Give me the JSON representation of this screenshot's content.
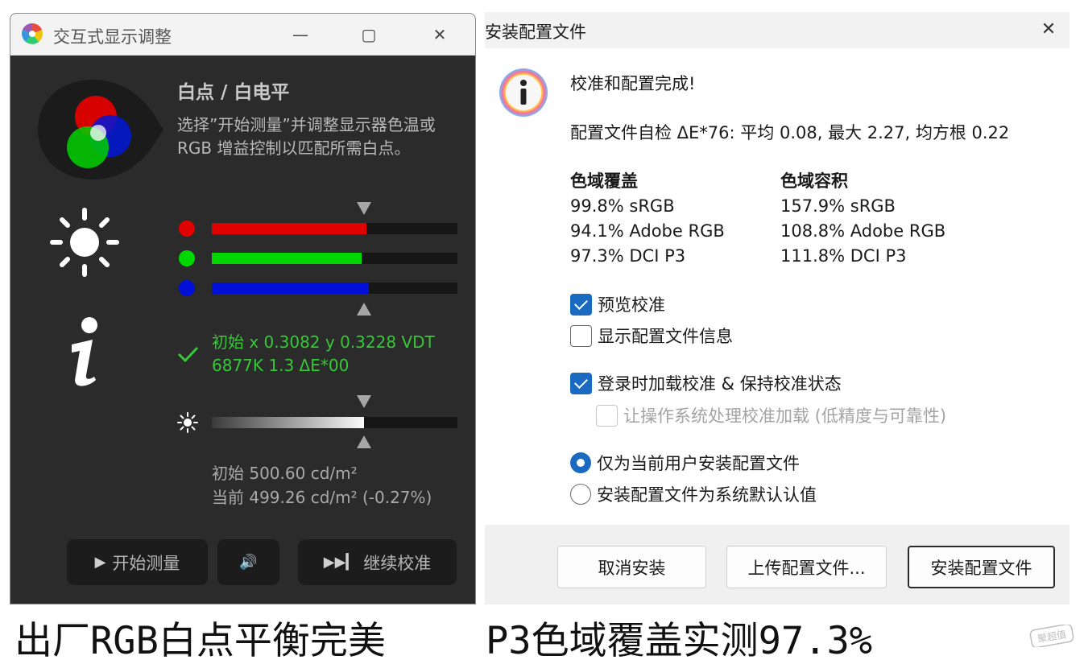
{
  "left_window": {
    "title": "交互式显示调整",
    "controls": {
      "minimize": "—",
      "maximize": "▢",
      "close": "✕"
    },
    "heading": "白点 / 白电平",
    "description": "选择”开始测量”并调整显示器色温或\nRGB 增益控制以匹配所需白点。",
    "rgb_gains": {
      "red": 0.63,
      "green": 0.61,
      "blue": 0.64,
      "target": 0.62
    },
    "status_line1": "初始 x 0.3082 y 0.3228 VDT",
    "status_line2": "6877K 1.3 ΔE*00",
    "luminance_level": 0.62,
    "luminance_initial": "初始 500.60 cd/m²",
    "luminance_current": "当前 499.26 cd/m² (-0.27%)",
    "buttons": {
      "start_glyph": "▶",
      "start_label": "开始测量",
      "sound_glyph": "🔊",
      "continue_glyph": "▶▶▎",
      "continue_label": "继续校准"
    },
    "colors": {
      "red": "#e00000",
      "green": "#00d800",
      "blue": "#0010d8",
      "check": "#37c837"
    }
  },
  "right_window": {
    "title": "安装配置文件",
    "close": "✕",
    "headline": "校准和配置完成!",
    "selfcheck": "配置文件自检 ΔE*76: 平均 0.08, 最大 2.27, 均方根 0.22",
    "coverage": {
      "header": "色域覆盖",
      "rows": [
        "99.8% sRGB",
        "94.1% Adobe RGB",
        "97.3% DCI P3"
      ]
    },
    "volume": {
      "header": "色域容积",
      "rows": [
        "157.9% sRGB",
        "108.8% Adobe RGB",
        "111.8% DCI P3"
      ]
    },
    "options": {
      "preview_calibration": "预览校准",
      "show_profile_info": "显示配置文件信息",
      "load_on_login": "登录时加载校准 & 保持校准状态",
      "let_os_handle": "让操作系统处理校准加载 (低精度与可靠性)",
      "install_current_user": "仅为当前用户安装配置文件",
      "install_system_default": "安装配置文件为系统默认认值"
    },
    "buttons": {
      "cancel": "取消安装",
      "upload": "上传配置文件...",
      "install": "安装配置文件"
    }
  },
  "captions": {
    "left": "出厂RGB白点平衡完美",
    "right": "P3色域覆盖实测97.3%",
    "watermark": "聚超值"
  }
}
